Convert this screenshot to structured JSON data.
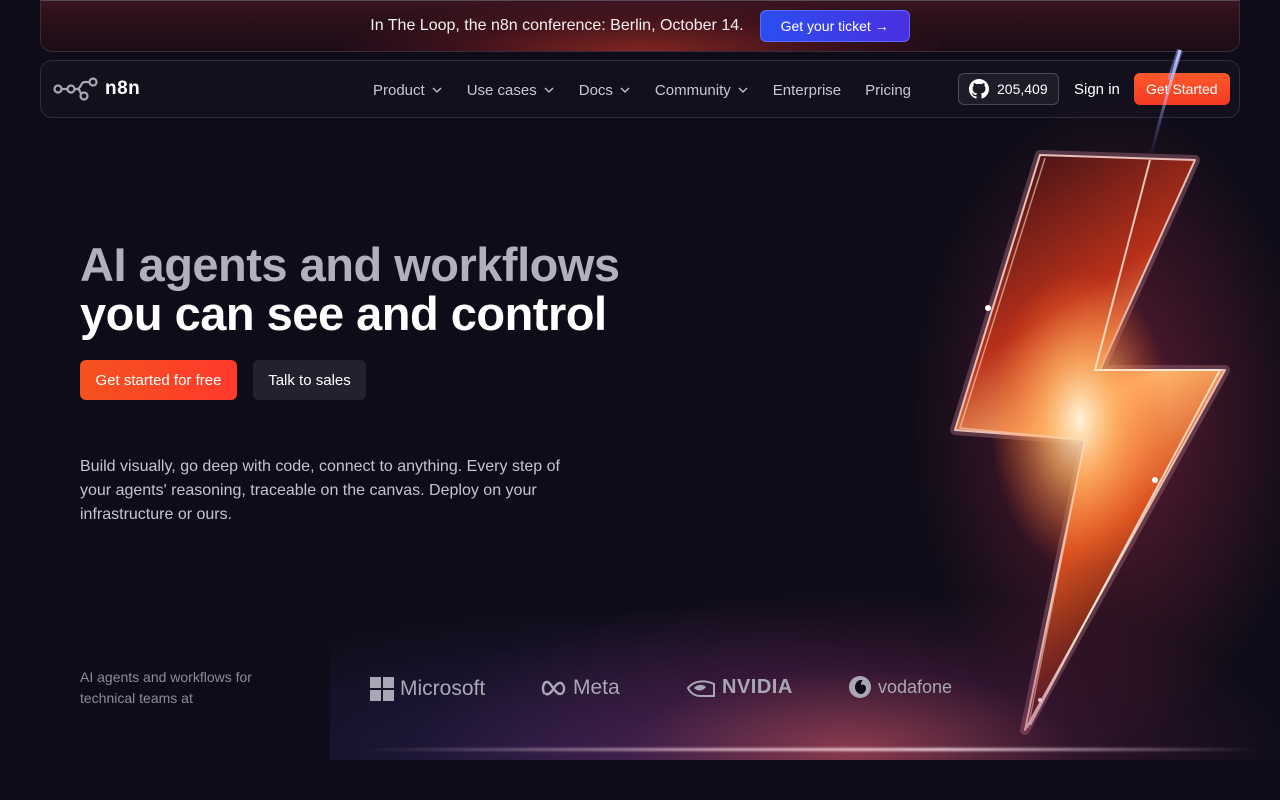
{
  "banner": {
    "text": "In The Loop, the n8n conference: Berlin, October 14.",
    "button": "Get your ticket →"
  },
  "nav": {
    "logo_text": "n8n",
    "links": [
      {
        "label": "Product",
        "dropdown": true
      },
      {
        "label": "Use cases",
        "dropdown": true
      },
      {
        "label": "Docs",
        "dropdown": true
      },
      {
        "label": "Community",
        "dropdown": true
      },
      {
        "label": "Enterprise",
        "dropdown": false
      },
      {
        "label": "Pricing",
        "dropdown": false
      }
    ],
    "github_stars": "205,409",
    "sign_in": "Sign in",
    "get_started": "Get Started"
  },
  "hero": {
    "title_line1": "AI agents and workflows",
    "title_line2": "you can see and control",
    "cta_primary": "Get started for free",
    "cta_secondary": "Talk to sales",
    "description": "Build visually, go deep with code, connect to anything. Every step of your agents' reasoning, traceable on the canvas. Deploy on your infrastructure or ours."
  },
  "trust": {
    "text": "AI agents and workflows for technical teams at",
    "brands": [
      "Microsoft",
      "Meta",
      "NVIDIA",
      "vodafone"
    ]
  },
  "colors": {
    "accent": "#ff4f2a",
    "banner_button": "#3a3ff0",
    "background": "#0e0c18"
  }
}
